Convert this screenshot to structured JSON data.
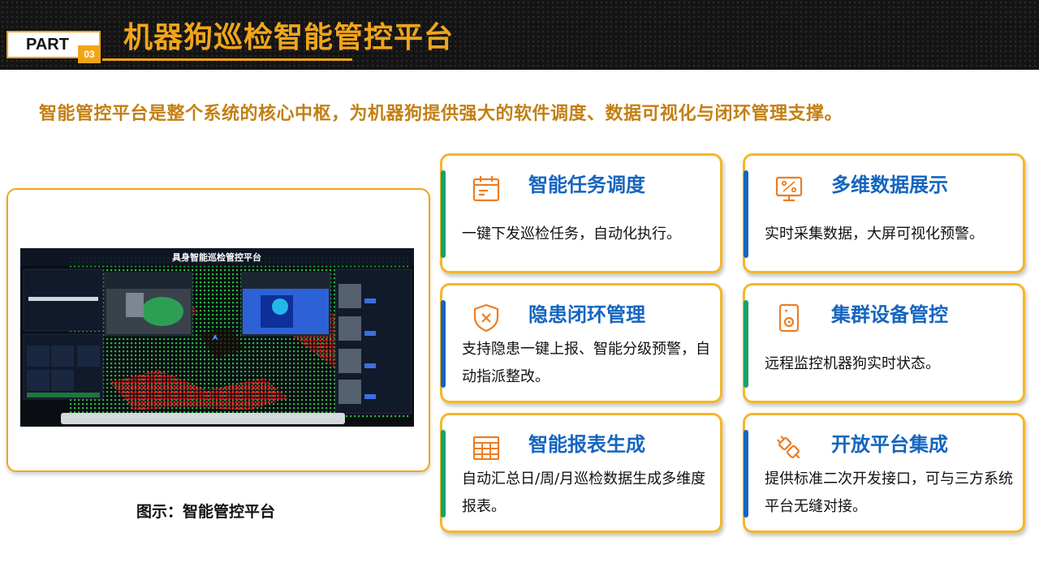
{
  "header": {
    "part_label": "PART",
    "part_number": "03",
    "title": "机器狗巡检智能管控平台"
  },
  "subtitle": "智能管控平台是整个系统的核心中枢，为机器狗提供强大的软件调度、数据可视化与闭环管理支撑。",
  "screenshot": {
    "dashboard_title": "具身智能巡检管控平台",
    "caption": "图示：智能管控平台"
  },
  "features": [
    {
      "icon": "calendar-icon",
      "title": "智能任务调度",
      "desc": "一键下发巡检任务，自动化执行。",
      "accent": "#16a36a"
    },
    {
      "icon": "monitor-chart-icon",
      "title": "多维数据展示",
      "desc": "实时采集数据，大屏可视化预警。",
      "accent": "#1565c0"
    },
    {
      "icon": "shield-icon",
      "title": "隐患闭环管理",
      "desc": "支持隐患一键上报、智能分级预警，自动指派整改。",
      "accent": "#1565c0"
    },
    {
      "icon": "device-control-icon",
      "title": "集群设备管控",
      "desc": "远程监控机器狗实时状态。",
      "accent": "#16a36a"
    },
    {
      "icon": "table-icon",
      "title": "智能报表生成",
      "desc": "自动汇总日/周/月巡检数据生成多维度报表。",
      "accent": "#16a36a"
    },
    {
      "icon": "plug-icon",
      "title": "开放平台集成",
      "desc": "提供标准二次开发接口，可与三方系统平台无缝对接。",
      "accent": "#1565c0"
    }
  ],
  "colors": {
    "brand": "#f2a51a",
    "title_blue": "#1565c0",
    "subtitle": "#c37f12",
    "icon": "#ee7d22"
  }
}
